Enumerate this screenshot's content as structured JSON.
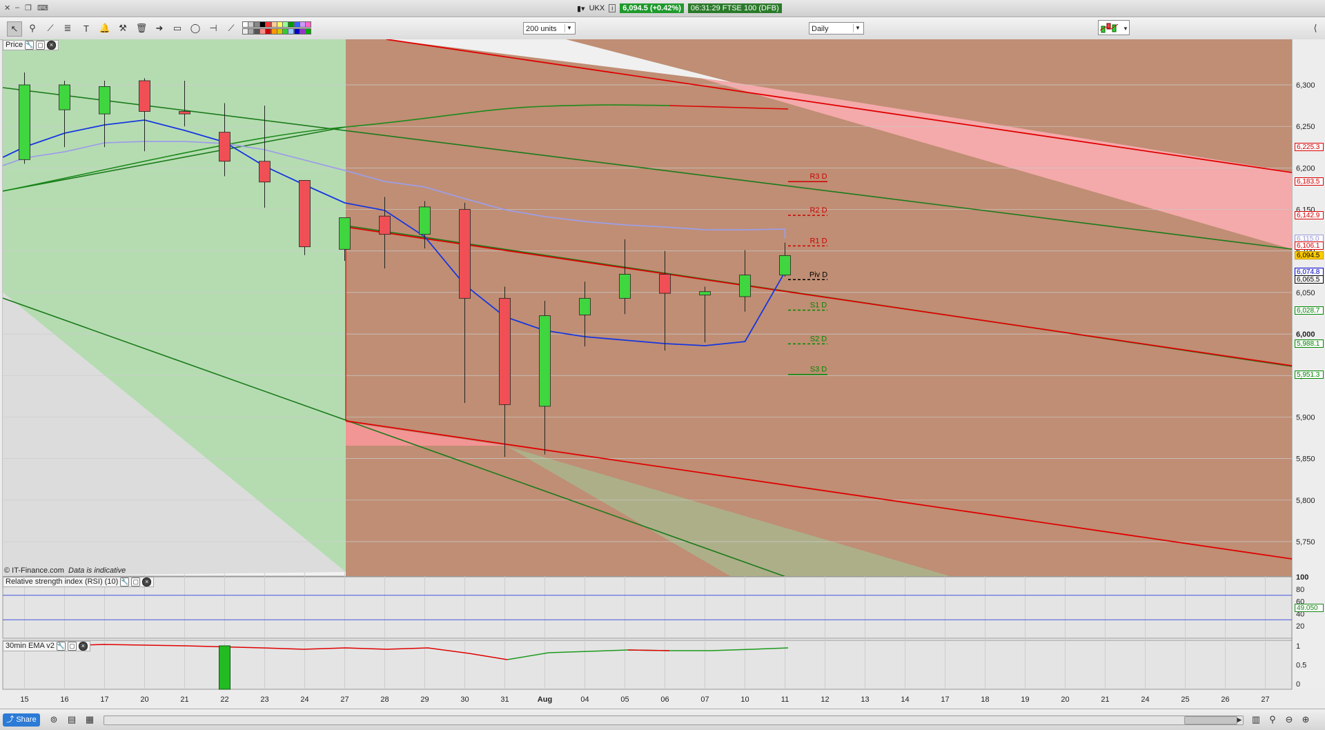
{
  "window": {
    "instrument": "UKX",
    "quote": "6,094.5 (+0.42%)",
    "time_desc": "06:31:29 FTSE 100 (DFB)"
  },
  "toolbar": {
    "units_select": "200 units",
    "interval_select": "Daily",
    "swatch_colors": [
      "#ffffff",
      "#eeeeee",
      "#cccccc",
      "#aaaaaa",
      "#888888",
      "#555555",
      "#000000",
      "#ff8888",
      "#ff3333",
      "#cc0000",
      "#ffcc99",
      "#ff9900",
      "#ffff66",
      "#cccc00",
      "#99ff99",
      "#33cc33",
      "#009900",
      "#99ccff",
      "#3366ff",
      "#0000cc",
      "#cc99ff",
      "#9933cc",
      "#ff66cc",
      "#00aa00"
    ]
  },
  "price_panel": {
    "label": "Price",
    "footer": "© IT-Finance.com",
    "footer_italic": "Data is indicative"
  },
  "rsi_panel": {
    "label": "Relative strength index (RSI) (10)",
    "ticks": [
      "100",
      "80",
      "60",
      "40",
      "20"
    ],
    "value_tag": "49.050"
  },
  "ema_panel": {
    "label": "30min EMA v2",
    "ticks": [
      "1",
      "0.5",
      "0"
    ]
  },
  "price_axis_ticks": [
    "6,300",
    "6,250",
    "6,200",
    "6,150",
    "6,100",
    "6,050",
    "6,000",
    "5,950",
    "5,900",
    "5,850",
    "5,800",
    "5,750"
  ],
  "price_tags": [
    {
      "text": "6,225.3",
      "color": "#dd0000",
      "price": 6225.3
    },
    {
      "text": "6,183.5",
      "color": "#dd0000",
      "price": 6183.5
    },
    {
      "text": "6,142.9",
      "color": "#dd0000",
      "price": 6142.9
    },
    {
      "text": "6,115.0",
      "color": "#9999dd",
      "price": 6115.0
    },
    {
      "text": "6,106.1",
      "color": "#dd0000",
      "price": 6106.1
    },
    {
      "text": "6,094.5",
      "color": "#000000",
      "price": 6094.5,
      "bg": "#ffcc00"
    },
    {
      "text": "6,074.8",
      "color": "#0000cc",
      "price": 6074.8
    },
    {
      "text": "6,065.5",
      "color": "#000000",
      "price": 6065.5
    },
    {
      "text": "6,028.7",
      "color": "#008800",
      "price": 6028.7
    },
    {
      "text": "5,988.1",
      "color": "#008800",
      "price": 5988.1
    },
    {
      "text": "5,951.3",
      "color": "#008800",
      "price": 5951.3
    }
  ],
  "pivot_labels": [
    {
      "text": "R3 D",
      "price": 6183.5,
      "color": "#cc0000",
      "dash": false
    },
    {
      "text": "R2 D",
      "price": 6142.9,
      "color": "#cc0000",
      "dash": true
    },
    {
      "text": "R1 D",
      "price": 6106.1,
      "color": "#cc0000",
      "dash": true
    },
    {
      "text": "Piv D",
      "price": 6065.5,
      "color": "#000000",
      "dash": true
    },
    {
      "text": "S1 D",
      "price": 6028.7,
      "color": "#008800",
      "dash": true
    },
    {
      "text": "S2 D",
      "price": 5988.1,
      "color": "#008800",
      "dash": true
    },
    {
      "text": "S3 D",
      "price": 5951.3,
      "color": "#008800",
      "dash": false
    }
  ],
  "x_axis": [
    "15",
    "16",
    "17",
    "20",
    "21",
    "22",
    "23",
    "24",
    "27",
    "28",
    "29",
    "30",
    "31",
    "Aug",
    "04",
    "05",
    "06",
    "07",
    "10",
    "11",
    "12",
    "13",
    "14",
    "17",
    "18",
    "19",
    "20",
    "21",
    "24",
    "25",
    "26",
    "27"
  ],
  "chart_data": {
    "type": "candlestick",
    "categories": [
      "15",
      "16",
      "17",
      "20",
      "21",
      "22",
      "23",
      "24",
      "27",
      "28",
      "29",
      "30",
      "31",
      "Aug",
      "04",
      "05",
      "06",
      "07",
      "10",
      "11"
    ],
    "candles": [
      {
        "o": 6210,
        "h": 6315,
        "l": 6205,
        "c": 6300
      },
      {
        "o": 6270,
        "h": 6305,
        "l": 6225,
        "c": 6300
      },
      {
        "o": 6265,
        "h": 6305,
        "l": 6225,
        "c": 6298
      },
      {
        "o": 6305,
        "h": 6308,
        "l": 6220,
        "c": 6268
      },
      {
        "o": 6268,
        "h": 6305,
        "l": 6250,
        "c": 6265
      },
      {
        "o": 6243,
        "h": 6278,
        "l": 6190,
        "c": 6208
      },
      {
        "o": 6208,
        "h": 6275,
        "l": 6152,
        "c": 6183
      },
      {
        "o": 6185,
        "h": 6185,
        "l": 6095,
        "c": 6105
      },
      {
        "o": 6102,
        "h": 6130,
        "l": 6088,
        "c": 6140
      },
      {
        "o": 6142,
        "h": 6165,
        "l": 6079,
        "c": 6120
      },
      {
        "o": 6120,
        "h": 6160,
        "l": 6103,
        "c": 6153
      },
      {
        "o": 6150,
        "h": 6158,
        "l": 5917,
        "c": 6043
      },
      {
        "o": 6043,
        "h": 6057,
        "l": 5852,
        "c": 5915
      },
      {
        "o": 5913,
        "h": 6040,
        "l": 5855,
        "c": 6022
      },
      {
        "o": 6023,
        "h": 6063,
        "l": 5985,
        "c": 6043
      },
      {
        "o": 6043,
        "h": 6114,
        "l": 6024,
        "c": 6072
      },
      {
        "o": 6072,
        "h": 6100,
        "l": 5980,
        "c": 6049
      },
      {
        "o": 6047,
        "h": 6057,
        "l": 5990,
        "c": 6051
      },
      {
        "o": 6045,
        "h": 6101,
        "l": 6027,
        "c": 6071
      },
      {
        "o": 6071,
        "h": 6110,
        "l": 6069,
        "c": 6094.5
      }
    ],
    "ylim": [
      5720,
      6312
    ]
  }
}
